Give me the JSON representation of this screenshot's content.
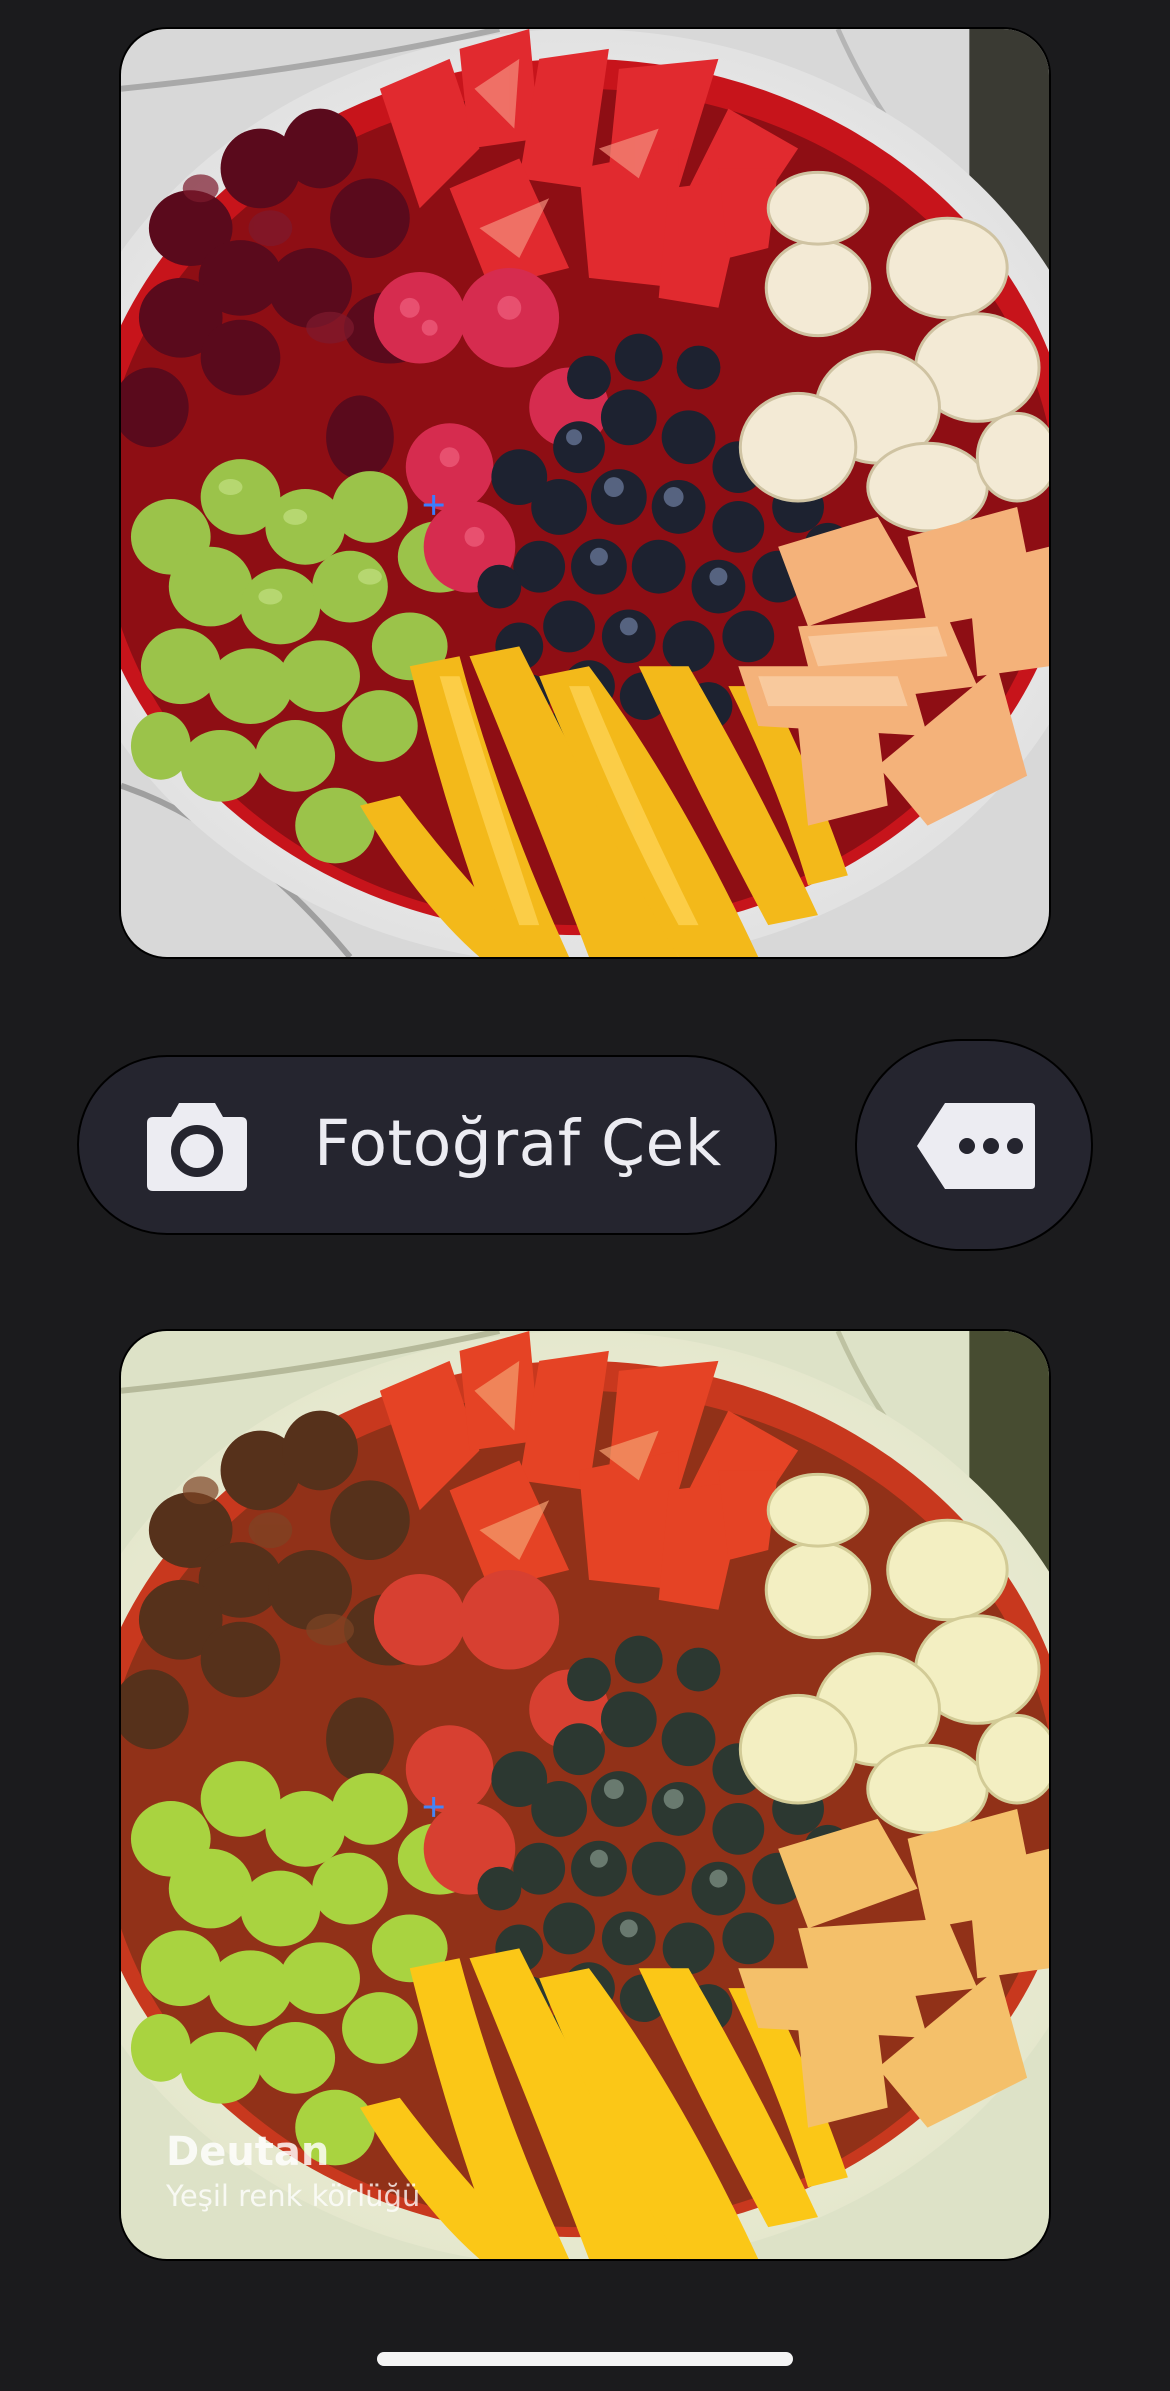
{
  "camera_button": {
    "label": "Fotoğraf Çek",
    "icon": "camera-icon"
  },
  "more_button": {
    "icon": "more-options-tag-icon"
  },
  "original_photo": {
    "subject": "fruit-platter-photo",
    "marker": "crosshair-icon"
  },
  "simulated_photo": {
    "subject": "fruit-platter-photo",
    "marker": "crosshair-icon",
    "filter_name": "Deutan",
    "filter_description": "Yeşil renk körlüğü"
  },
  "colors": {
    "background": "#1b1b1d",
    "button_fill": "#25252f",
    "button_text": "#ececf2",
    "marker": "#3b7cff"
  }
}
